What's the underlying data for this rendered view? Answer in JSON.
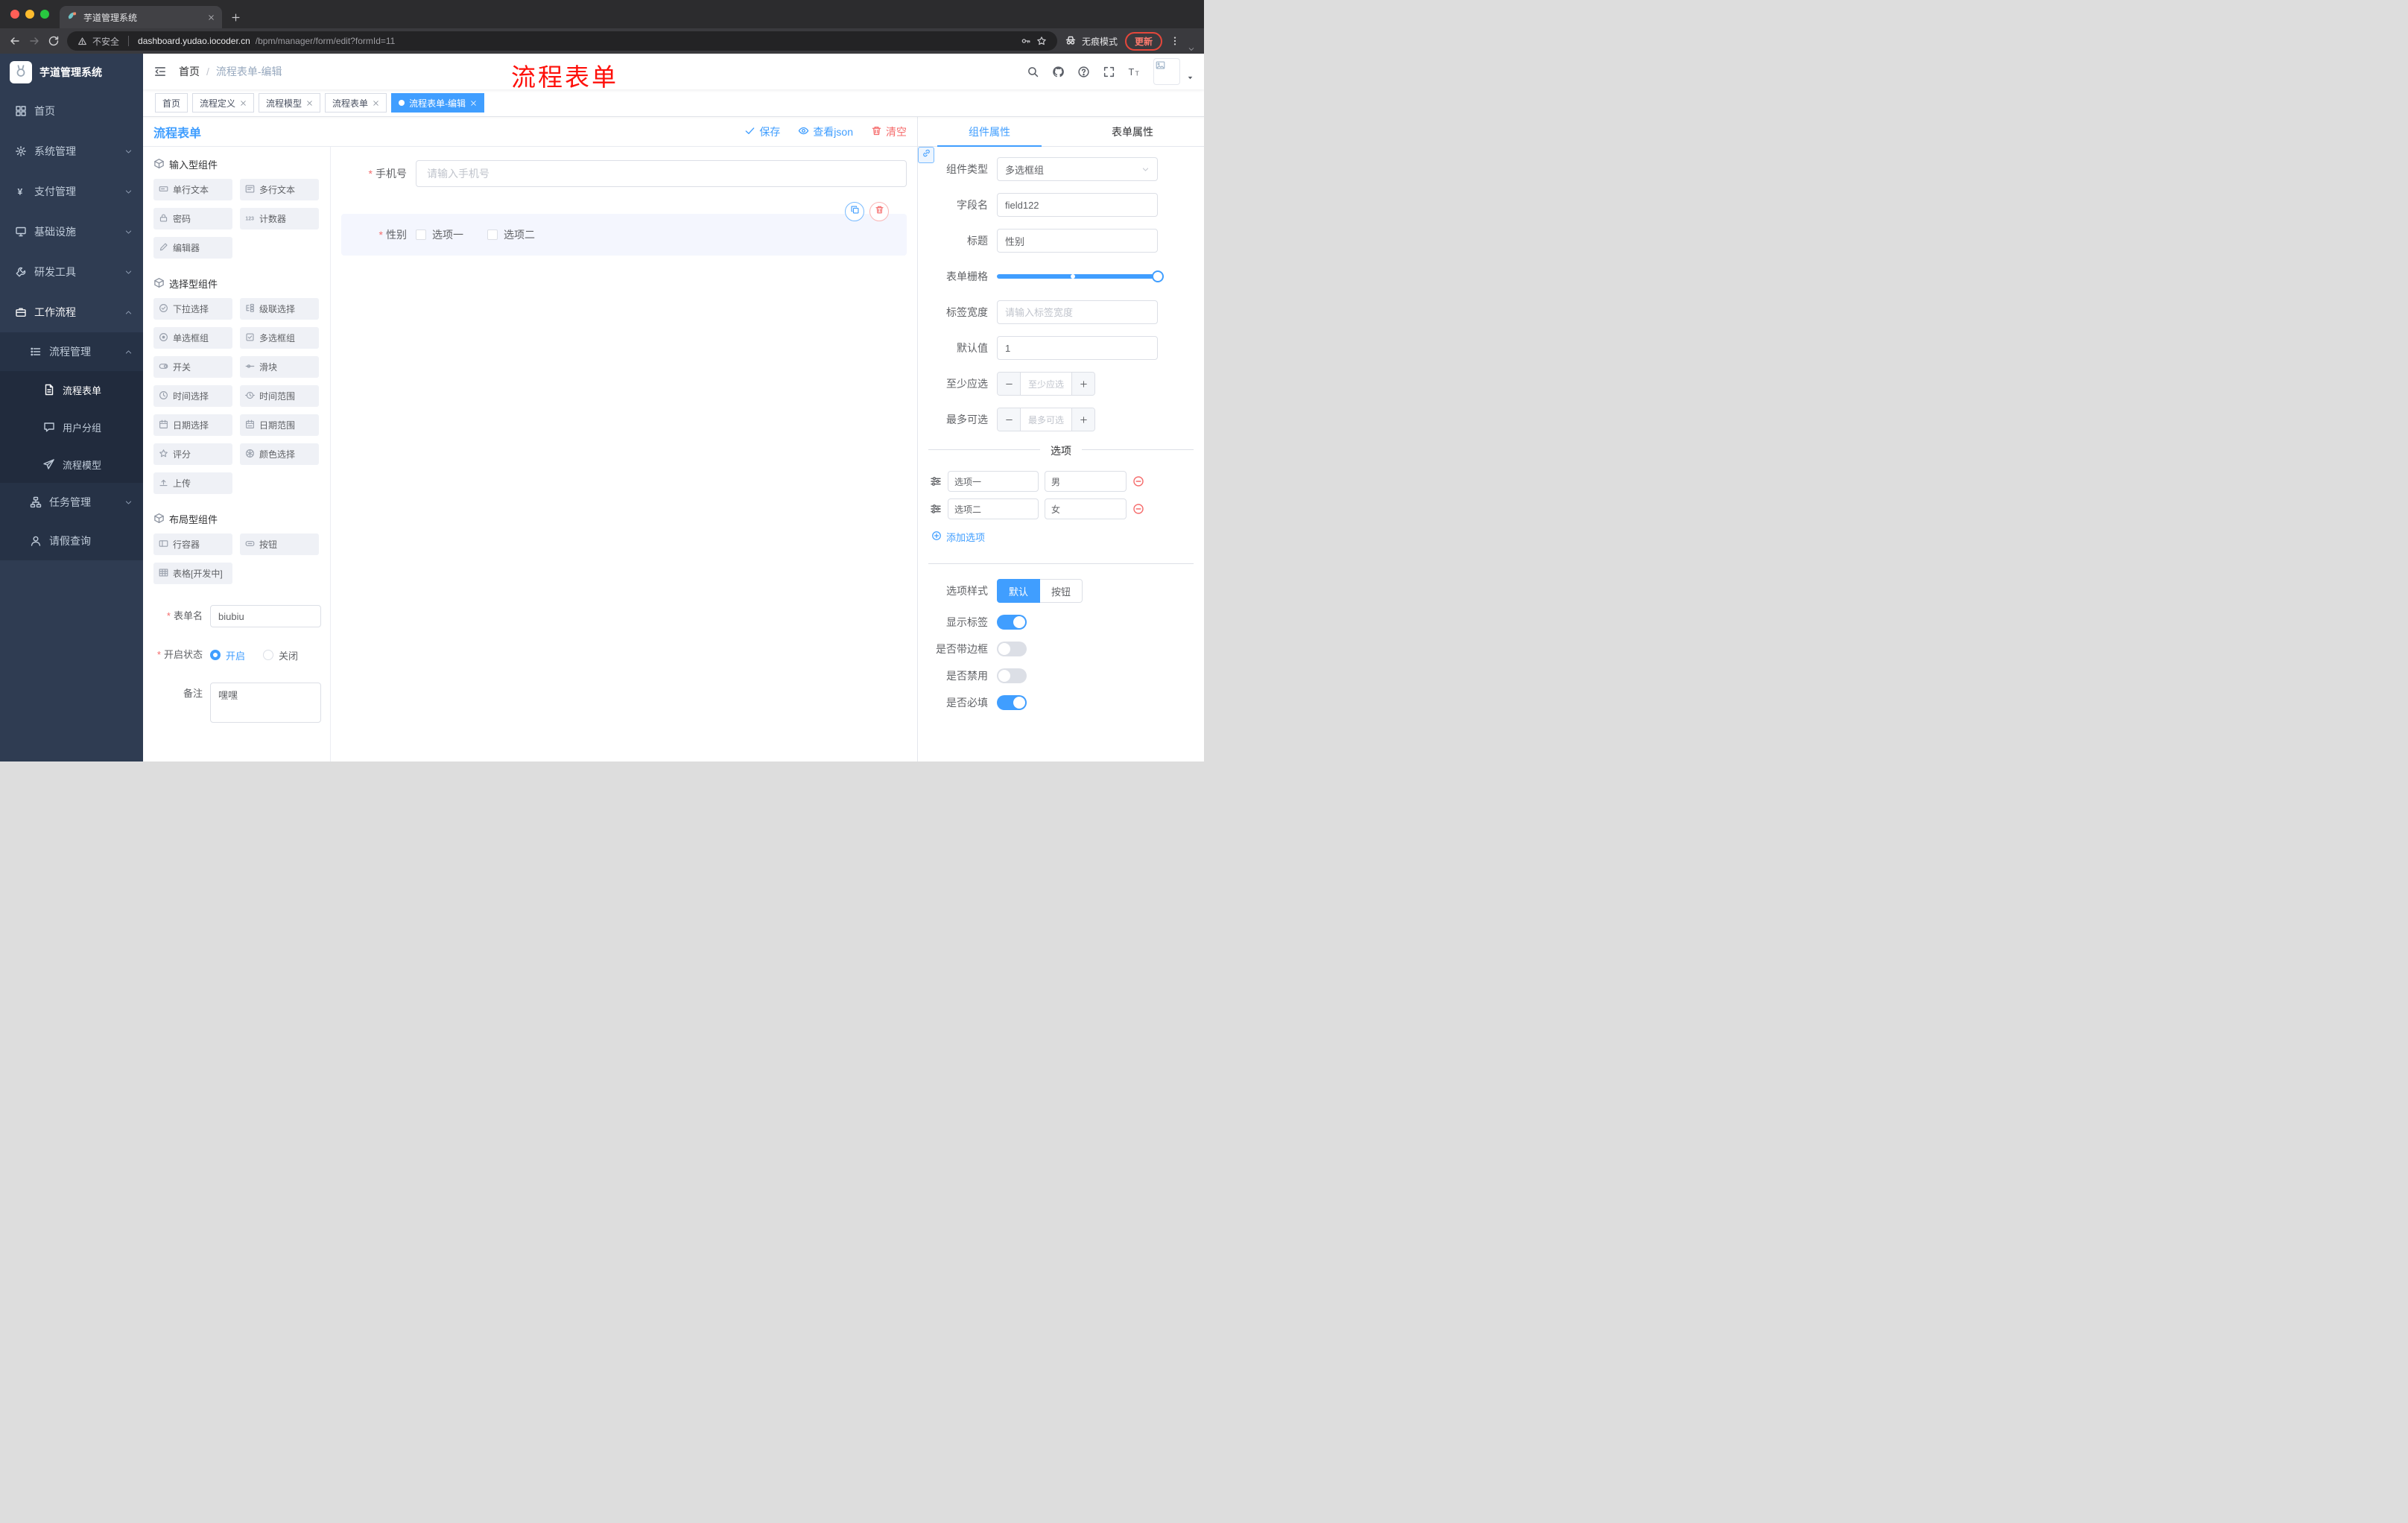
{
  "colors": {
    "primary": "#409EFF",
    "danger": "#F56C6C",
    "sidebar_bg": "#2F3C52",
    "annotation_red": "#FE100A",
    "active_tag_bg": "#409EFF"
  },
  "browser": {
    "tab_title": "芋道管理系统",
    "security": "不安全",
    "url_host": "dashboard.yudao.iocoder.cn",
    "url_path": "/bpm/manager/form/edit?formId=11",
    "incognito": "无痕模式",
    "update": "更新"
  },
  "header": {
    "breadcrumb_home": "首页",
    "breadcrumb_sep": "/",
    "breadcrumb_current": "流程表单-编辑",
    "watermark": "流程表单"
  },
  "tags": [
    {
      "label": "首页",
      "closable": false,
      "active": false
    },
    {
      "label": "流程定义",
      "closable": true,
      "active": false
    },
    {
      "label": "流程模型",
      "closable": true,
      "active": false
    },
    {
      "label": "流程表单",
      "closable": true,
      "active": false
    },
    {
      "label": "流程表单-编辑",
      "closable": true,
      "active": true
    }
  ],
  "sidebar": {
    "title": "芋道管理系统",
    "menu": [
      {
        "label": "首页",
        "icon": "home"
      },
      {
        "label": "系统管理",
        "icon": "gear"
      },
      {
        "label": "支付管理",
        "icon": "yen"
      },
      {
        "label": "基础设施",
        "icon": "infra"
      },
      {
        "label": "研发工具",
        "icon": "tool"
      },
      {
        "label": "工作流程",
        "icon": "suitcase",
        "expanded": true
      }
    ],
    "submenu": {
      "parent": {
        "label": "流程管理",
        "expanded": true
      },
      "children": [
        {
          "label": "流程表单",
          "active": true
        },
        {
          "label": "用户分组",
          "active": false
        },
        {
          "label": "流程模型",
          "active": false
        }
      ],
      "task": {
        "label": "任务管理",
        "expanded": false
      },
      "leave": {
        "label": "请假查询"
      }
    }
  },
  "designer": {
    "title": "流程表单",
    "save": "保存",
    "view_json": "查看json",
    "clear": "清空"
  },
  "palette": {
    "sections": [
      {
        "title": "输入型组件",
        "items": [
          {
            "label": "单行文本",
            "icon": "input"
          },
          {
            "label": "多行文本",
            "icon": "textarea"
          },
          {
            "label": "密码",
            "icon": "password"
          },
          {
            "label": "计数器",
            "icon": "counter"
          },
          {
            "label": "编辑器",
            "icon": "editor"
          }
        ]
      },
      {
        "title": "选择型组件",
        "items": [
          {
            "label": "下拉选择",
            "icon": "select"
          },
          {
            "label": "级联选择",
            "icon": "cascader"
          },
          {
            "label": "单选框组",
            "icon": "radio"
          },
          {
            "label": "多选框组",
            "icon": "checkbox"
          },
          {
            "label": "开关",
            "icon": "switch"
          },
          {
            "label": "滑块",
            "icon": "slider"
          },
          {
            "label": "时间选择",
            "icon": "time"
          },
          {
            "label": "时间范围",
            "icon": "timerange"
          },
          {
            "label": "日期选择",
            "icon": "date"
          },
          {
            "label": "日期范围",
            "icon": "daterange"
          },
          {
            "label": "评分",
            "icon": "star"
          },
          {
            "label": "颜色选择",
            "icon": "color"
          },
          {
            "label": "上传",
            "icon": "upload"
          }
        ]
      },
      {
        "title": "布局型组件",
        "items": [
          {
            "label": "行容器",
            "icon": "row"
          },
          {
            "label": "按钮",
            "icon": "btn"
          },
          {
            "label": "表格[开发中]",
            "icon": "table"
          }
        ]
      }
    ]
  },
  "form_meta": {
    "name_label": "表单名",
    "name_value": "biubiu",
    "status_label": "开启状态",
    "status_on": "开启",
    "status_off": "关闭",
    "remark_label": "备注",
    "remark_value": "嘿嘿"
  },
  "canvas": {
    "phone_label": "手机号",
    "phone_placeholder": "请输入手机号",
    "gender_label": "性别",
    "gender_options": [
      "选项一",
      "选项二"
    ]
  },
  "props": {
    "tab_component": "组件属性",
    "tab_form": "表单属性",
    "type_label": "组件类型",
    "type_value": "多选框组",
    "field_label": "字段名",
    "field_value": "field122",
    "title_label": "标题",
    "title_value": "性别",
    "grid_label": "表单栅格",
    "width_label": "标签宽度",
    "width_placeholder": "请输入标签宽度",
    "default_label": "默认值",
    "default_value": "1",
    "min_label": "至少应选",
    "min_placeholder": "至少应选",
    "max_label": "最多可选",
    "max_placeholder": "最多可选",
    "options_divider": "选项",
    "options": [
      {
        "label": "选项一",
        "value": "男"
      },
      {
        "label": "选项二",
        "value": "女"
      }
    ],
    "add_option": "添加选项",
    "style_label": "选项样式",
    "style_options": [
      "默认",
      "按钮"
    ],
    "switches": [
      {
        "label": "显示标签",
        "on": true
      },
      {
        "label": "是否带边框",
        "on": false
      },
      {
        "label": "是否禁用",
        "on": false
      },
      {
        "label": "是否必填",
        "on": true
      }
    ]
  }
}
